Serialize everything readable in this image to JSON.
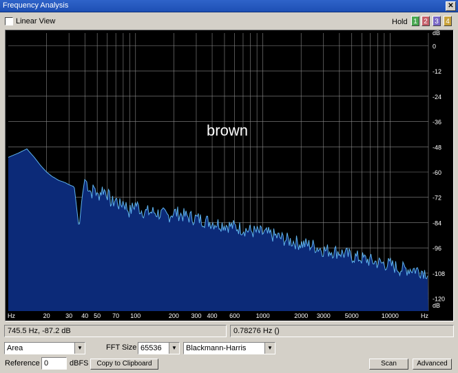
{
  "window": {
    "title": "Frequency Analysis",
    "close_label": "✕"
  },
  "toolbar": {
    "linear_view_label": "Linear View",
    "linear_view_checked": false,
    "hold_label": "Hold",
    "hold_buttons": [
      {
        "label": "1",
        "color": "#4aa852"
      },
      {
        "label": "2",
        "color": "#c55f6a"
      },
      {
        "label": "3",
        "color": "#7a68c6"
      },
      {
        "label": "4",
        "color": "#c8a23a"
      }
    ]
  },
  "plot": {
    "overlay_text": "brown",
    "fill_color": "#0c2a78",
    "line_color": "#5fb4f0",
    "grid_color": "#8c8c8c"
  },
  "chart_data": {
    "type": "area",
    "x_scale": "log",
    "xlabel": "Hz",
    "ylabel": "dB",
    "xlim": [
      10,
      20000
    ],
    "ylim": [
      -126,
      6
    ],
    "x_tick_labels": [
      "Hz",
      "20",
      "30",
      "40",
      "50",
      "70",
      "100",
      "200",
      "300",
      "400",
      "600",
      "1000",
      "2000",
      "3000",
      "5000",
      "10000",
      "Hz"
    ],
    "x_tick_values": [
      null,
      20,
      30,
      40,
      50,
      70,
      100,
      200,
      300,
      400,
      600,
      1000,
      2000,
      3000,
      5000,
      10000,
      null
    ],
    "y_tick_labels": [
      "dB",
      "0",
      "-12",
      "-24",
      "-36",
      "-48",
      "-60",
      "-72",
      "-84",
      "-96",
      "-108",
      "-120",
      "dB"
    ],
    "y_tick_values": [
      null,
      0,
      -12,
      -24,
      -36,
      -48,
      -60,
      -72,
      -84,
      -96,
      -108,
      -120,
      null
    ],
    "series": [
      {
        "x": [
          10,
          12,
          14,
          16,
          18,
          20,
          22,
          25,
          28,
          30,
          33,
          36,
          38,
          40,
          42,
          45,
          48,
          50,
          55,
          60,
          65,
          70,
          75,
          80,
          90,
          100,
          110,
          120,
          140,
          160,
          180,
          200,
          250,
          300,
          350,
          400,
          500,
          600,
          700,
          800,
          1000,
          1200,
          1500,
          2000,
          2500,
          3000,
          4000,
          5000,
          6000,
          8000,
          10000,
          12000,
          15000,
          18000,
          20000
        ],
        "y": [
          -53,
          -51,
          -49,
          -53,
          -57,
          -60,
          -62,
          -64,
          -65,
          -66,
          -67,
          -87,
          -72,
          -63,
          -66,
          -70,
          -67,
          -72,
          -68,
          -70,
          -75,
          -73,
          -76,
          -74,
          -79,
          -75,
          -78,
          -79,
          -79,
          -80,
          -81,
          -79,
          -81,
          -82,
          -83,
          -84,
          -85,
          -86,
          -87,
          -88,
          -89,
          -90,
          -92,
          -94,
          -95,
          -97,
          -98,
          -100,
          -101,
          -103,
          -104,
          -106,
          -106,
          -107,
          -108
        ]
      }
    ]
  },
  "status": {
    "cursor_readout": "745.5 Hz,  -87.2 dB",
    "resolution": "0.78276 Hz ()"
  },
  "controls": {
    "display_mode": "Area",
    "fft_size_label": "FFT Size",
    "fft_size": "65536",
    "window_function": "Blackmann-Harris",
    "reference_label": "Reference",
    "reference_value": "0",
    "reference_unit": "dBFS",
    "copy_label": "Copy to Clipboard",
    "scan_label": "Scan",
    "advanced_label": "Advanced"
  }
}
